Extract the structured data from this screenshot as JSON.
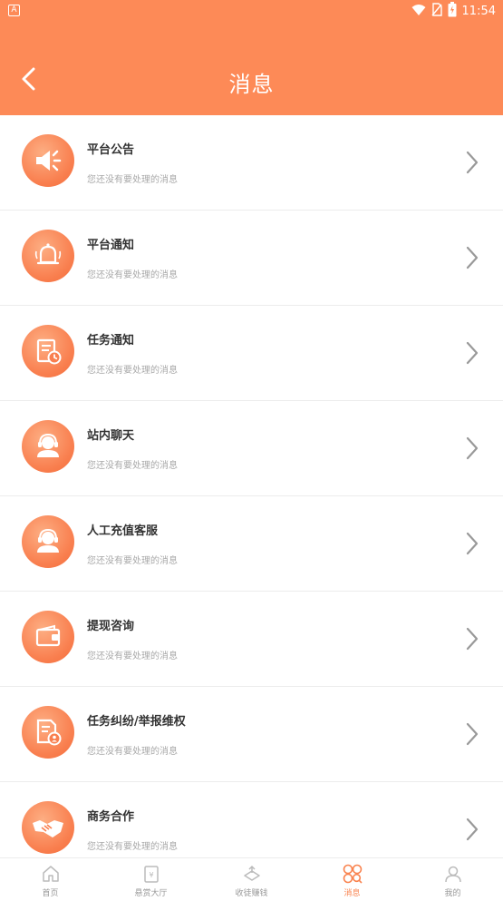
{
  "status_bar": {
    "left_badge": "A",
    "time": "11:54"
  },
  "header": {
    "title": "消息"
  },
  "messages": [
    {
      "title": "平台公告",
      "subtitle": "您还没有要处理的消息",
      "icon": "megaphone-icon"
    },
    {
      "title": "平台通知",
      "subtitle": "您还没有要处理的消息",
      "icon": "bell-icon"
    },
    {
      "title": "任务通知",
      "subtitle": "您还没有要处理的消息",
      "icon": "task-clock-icon"
    },
    {
      "title": "站内聊天",
      "subtitle": "您还没有要处理的消息",
      "icon": "headset-agent-icon"
    },
    {
      "title": "人工充值客服",
      "subtitle": "您还没有要处理的消息",
      "icon": "headset-agent-icon"
    },
    {
      "title": "提现咨询",
      "subtitle": "您还没有要处理的消息",
      "icon": "wallet-icon"
    },
    {
      "title": "任务纠纷/举报维权",
      "subtitle": "您还没有要处理的消息",
      "icon": "document-person-icon"
    },
    {
      "title": "商务合作",
      "subtitle": "您还没有要处理的消息",
      "icon": "handshake-icon"
    }
  ],
  "bottom_nav": {
    "active_index": 3,
    "accent_color": "#f9834f",
    "items": [
      {
        "label": "首页",
        "icon": "home-icon"
      },
      {
        "label": "悬赏大厅",
        "icon": "reward-hall-icon"
      },
      {
        "label": "收徒赚钱",
        "icon": "earn-icon"
      },
      {
        "label": "消息",
        "icon": "message-grid-icon"
      },
      {
        "label": "我的",
        "icon": "user-icon"
      }
    ]
  },
  "colors": {
    "header": "#fd8a57",
    "icon_gradient_start": "#fdae83",
    "icon_gradient_end": "#f36d3b"
  }
}
